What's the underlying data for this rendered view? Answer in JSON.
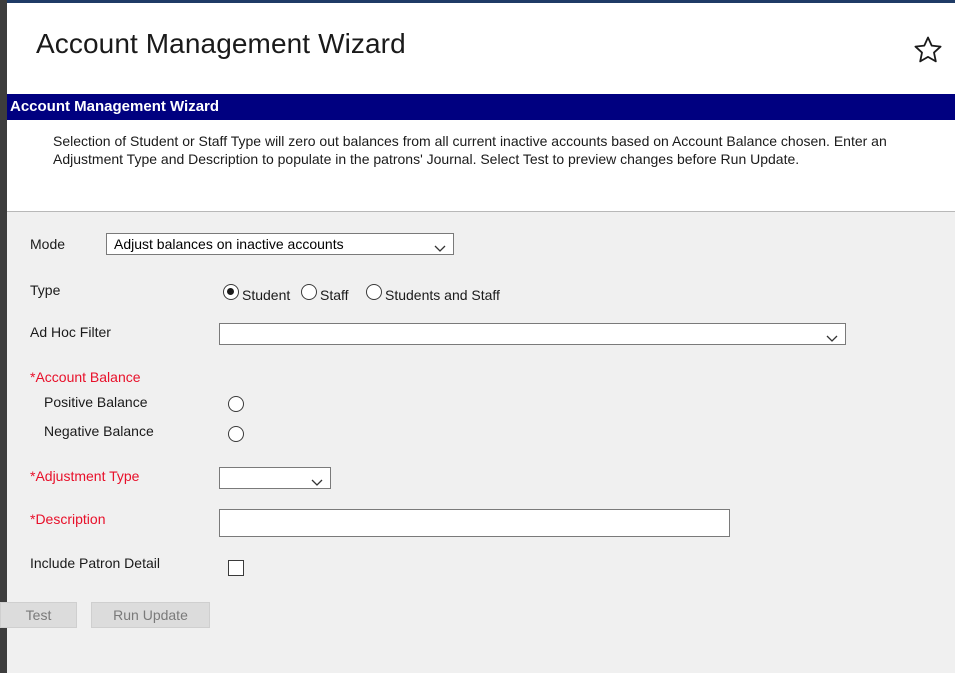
{
  "page": {
    "title": "Account Management Wizard"
  },
  "panel": {
    "header": "Account Management Wizard",
    "instructions": "Selection of Student or Staff Type will zero out balances from all current inactive accounts based on Account Balance chosen. Enter an Adjustment Type and Description to populate in the patrons' Journal. Select Test to preview changes before Run Update."
  },
  "form": {
    "mode": {
      "label": "Mode",
      "value": "Adjust balances on inactive accounts"
    },
    "type": {
      "label": "Type",
      "options": [
        {
          "label": "Student",
          "checked": true
        },
        {
          "label": "Staff",
          "checked": false
        },
        {
          "label": "Students and Staff",
          "checked": false
        }
      ]
    },
    "ad_hoc_filter": {
      "label": "Ad Hoc Filter",
      "value": ""
    },
    "account_balance": {
      "label": "*Account Balance",
      "positive_label": "Positive Balance",
      "negative_label": "Negative Balance"
    },
    "adjustment_type": {
      "label": "*Adjustment Type",
      "value": ""
    },
    "description": {
      "label": "*Description",
      "value": ""
    },
    "include_patron_detail": {
      "label": "Include Patron Detail",
      "checked": false
    }
  },
  "buttons": {
    "test": "Test",
    "run_update": "Run Update"
  },
  "colors": {
    "header_bar": "#000080",
    "required_label": "#e8102a",
    "form_background": "#f0f0f0"
  },
  "icons": {
    "favorite": "star-outline-icon",
    "dropdown": "chevron-down-icon"
  }
}
